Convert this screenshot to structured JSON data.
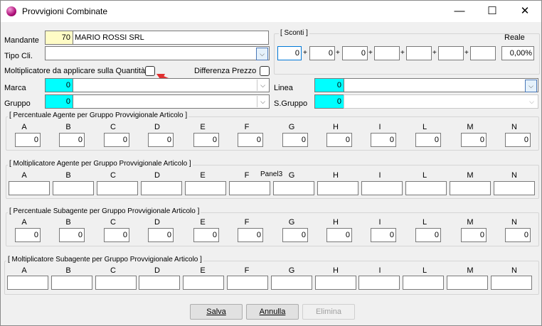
{
  "window": {
    "title": "Provvigioni Combinate",
    "controls": [
      "—",
      "☐",
      "✕"
    ]
  },
  "form": {
    "mandante_label": "Mandante",
    "mandante_code": "70",
    "mandante_name": "MARIO ROSSI SRL",
    "tipo_cli_label": "Tipo Cli.",
    "tipo_cli_value": "",
    "moltiplicatore_label": "Moltiplicatore da applicare sulla Quantità",
    "differenza_label": "Differenza Prezzo",
    "marca_label": "Marca",
    "marca_code": "0",
    "gruppo_label": "Gruppo",
    "gruppo_code": "0",
    "linea_label": "Linea",
    "linea_code": "0",
    "sgruppo_label": "S.Gruppo",
    "sgruppo_code": "0"
  },
  "sconti": {
    "title": "[ Sconti ]",
    "values": [
      "0",
      "0",
      "0",
      "",
      "",
      "",
      ""
    ],
    "reale_label": "Reale",
    "reale_value": "0,00%"
  },
  "columns": [
    "A",
    "B",
    "C",
    "D",
    "E",
    "F",
    "G",
    "H",
    "I",
    "L",
    "M",
    "N"
  ],
  "groups": {
    "perc_agente": {
      "title": "[ Percentuale Agente per Gruppo Provvigionale Articolo ]",
      "values": [
        "0",
        "0",
        "0",
        "0",
        "0",
        "0",
        "0",
        "0",
        "0",
        "0",
        "0",
        "0"
      ]
    },
    "molt_agente": {
      "title": "[ Moltiplicatore Agente per Gruppo Provvigionale Articolo ]",
      "panel_label": "Panel3",
      "values": [
        "",
        "",
        "",
        "",
        "",
        "",
        "",
        "",
        "",
        "",
        "",
        ""
      ]
    },
    "perc_subagente": {
      "title": "[ Percentuale Subagente per Gruppo Provvigionale Articolo ]",
      "values": [
        "0",
        "0",
        "0",
        "0",
        "0",
        "0",
        "0",
        "0",
        "0",
        "0",
        "0",
        "0"
      ]
    },
    "molt_subagente": {
      "title": "[ Moltiplicatore Subagente per Gruppo Provvigionale Articolo ]",
      "values": [
        "",
        "",
        "",
        "",
        "",
        "",
        "",
        "",
        "",
        "",
        "",
        ""
      ]
    }
  },
  "buttons": {
    "salva": "Salva",
    "annulla": "Annulla",
    "elimina": "Elimina"
  },
  "colors": {
    "accent_cyan": "#00ffff",
    "code_yellow": "#fffcc6",
    "arrow_red": "#e03030"
  }
}
